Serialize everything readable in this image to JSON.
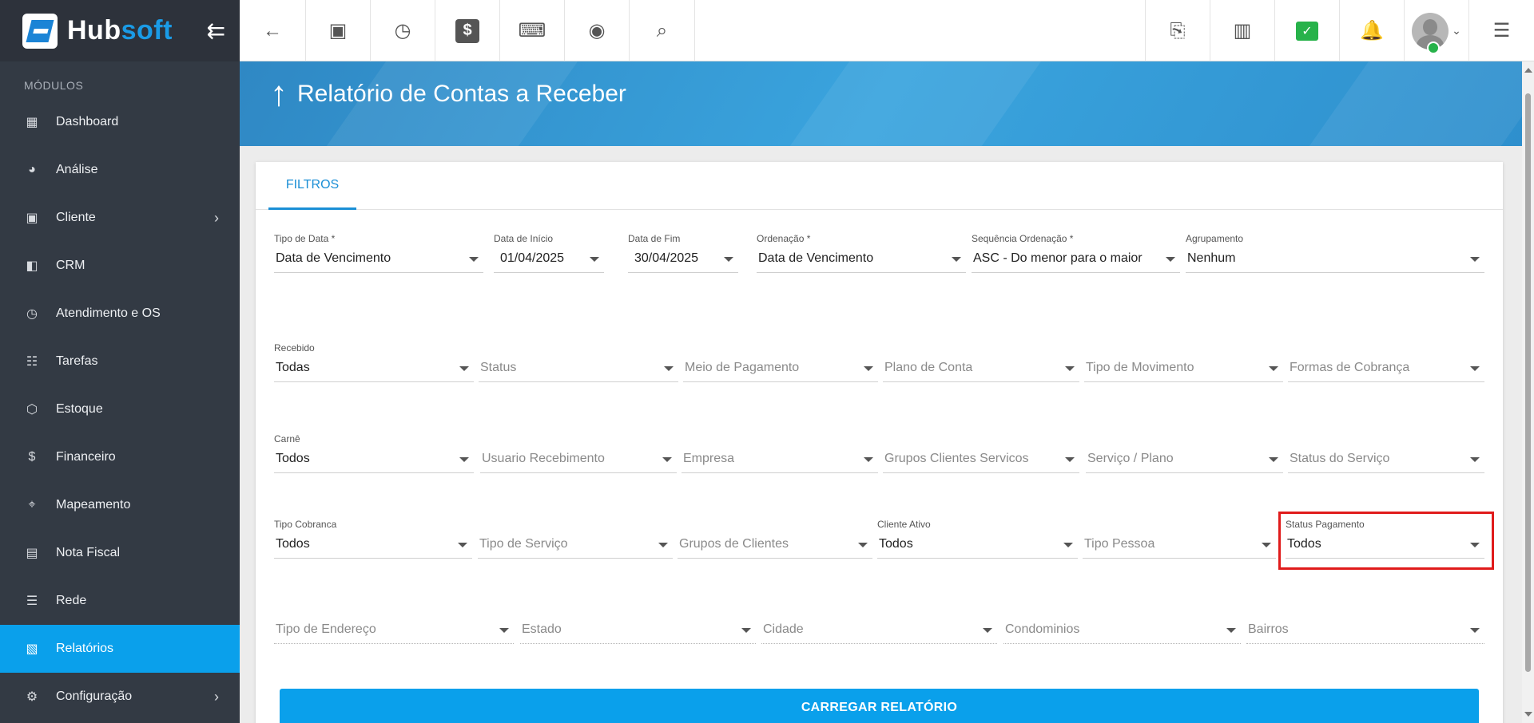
{
  "brand": {
    "hub": "Hub",
    "soft": "soft"
  },
  "sidebar": {
    "section_title": "MÓDULOS",
    "items": [
      {
        "label": "Dashboard",
        "icon": "grid-icon"
      },
      {
        "label": "Análise",
        "icon": "pie-chart-icon"
      },
      {
        "label": "Cliente",
        "icon": "contact-card-icon",
        "has_children": true
      },
      {
        "label": "CRM",
        "icon": "board-icon"
      },
      {
        "label": "Atendimento e OS",
        "icon": "calendar-clock-icon"
      },
      {
        "label": "Tarefas",
        "icon": "tasks-icon"
      },
      {
        "label": "Estoque",
        "icon": "box-icon"
      },
      {
        "label": "Financeiro",
        "icon": "dollar-icon"
      },
      {
        "label": "Mapeamento",
        "icon": "map-pin-icon"
      },
      {
        "label": "Nota Fiscal",
        "icon": "invoice-icon"
      },
      {
        "label": "Rede",
        "icon": "server-icon"
      },
      {
        "label": "Relatórios",
        "icon": "document-icon",
        "active": true
      },
      {
        "label": "Configuração",
        "icon": "gear-icon",
        "has_children": true
      }
    ]
  },
  "page": {
    "title": "Relatório de Contas a Receber"
  },
  "tabs": [
    {
      "label": "FILTROS"
    }
  ],
  "filters": {
    "row1": [
      {
        "label": "Tipo de Data *",
        "value": "Data de Vencimento"
      },
      {
        "label": "Data de Início",
        "value": "01/04/2025"
      },
      {
        "label": "Data de Fim",
        "value": "30/04/2025"
      },
      {
        "label": "Ordenação *",
        "value": "Data de Vencimento"
      },
      {
        "label": "Sequência Ordenação *",
        "value": "ASC - Do menor para o maior"
      },
      {
        "label": "Agrupamento",
        "value": "Nenhum"
      }
    ],
    "row2": [
      {
        "label": "Recebido",
        "value": "Todas"
      },
      {
        "label": "",
        "placeholder": "Status"
      },
      {
        "label": "",
        "placeholder": "Meio de Pagamento"
      },
      {
        "label": "",
        "placeholder": "Plano de Conta"
      },
      {
        "label": "",
        "placeholder": "Tipo de Movimento"
      },
      {
        "label": "",
        "placeholder": "Formas de Cobrança"
      }
    ],
    "row3": [
      {
        "label": "Carnê",
        "value": "Todos"
      },
      {
        "label": "",
        "placeholder": "Usuario Recebimento"
      },
      {
        "label": "",
        "placeholder": "Empresa"
      },
      {
        "label": "",
        "placeholder": "Grupos Clientes Servicos"
      },
      {
        "label": "",
        "placeholder": "Serviço / Plano"
      },
      {
        "label": "",
        "placeholder": "Status do Serviço"
      }
    ],
    "row4": [
      {
        "label": "Tipo Cobranca",
        "value": "Todos"
      },
      {
        "label": "",
        "placeholder": "Tipo de Serviço"
      },
      {
        "label": "",
        "placeholder": "Grupos de Clientes"
      },
      {
        "label": "Cliente Ativo",
        "value": "Todos"
      },
      {
        "label": "",
        "placeholder": "Tipo Pessoa"
      },
      {
        "label": "Status Pagamento",
        "value": "Todos"
      }
    ],
    "row5": [
      {
        "placeholder": "Tipo de Endereço"
      },
      {
        "placeholder": "Estado"
      },
      {
        "placeholder": "Cidade"
      },
      {
        "placeholder": "Condominios"
      },
      {
        "placeholder": "Bairros"
      }
    ]
  },
  "actions": {
    "load_report": "CARREGAR RELATÓRIO"
  },
  "colors": {
    "accent": "#0aa0eb",
    "sidebar": "#333a44",
    "highlight": "#e01b1b"
  }
}
